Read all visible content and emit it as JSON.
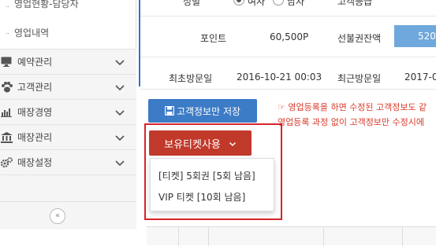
{
  "sidebar": {
    "sub_items": [
      "영업현황-담당자",
      "영업내역"
    ],
    "menus": [
      {
        "label": "예약관리",
        "icon": "monitor-icon"
      },
      {
        "label": "고객관리",
        "icon": "paw-icon"
      },
      {
        "label": "매장경영",
        "icon": "bar-chart-icon"
      },
      {
        "label": "매장관리",
        "icon": "building-icon"
      },
      {
        "label": "매장설정",
        "icon": "gears-icon"
      }
    ],
    "collapse_label": "«"
  },
  "customer_info": {
    "gender_label": "성별",
    "radio_option_1": "여자",
    "radio_option_2": "남자",
    "top_right_label": "고객등급",
    "points_label": "포인트",
    "points_value": "60,500P",
    "prepaid_label": "선불권잔액",
    "prepaid_value": "520,",
    "first_visit_label": "최초방문일",
    "first_visit_value": "2016-10-21 00:03",
    "last_visit_label": "최근방문일",
    "last_visit_value": "2017-0"
  },
  "actions": {
    "save_label": "고객정보만 저장",
    "notice_line1": "☞ 영업등록을 하면 수정된 고객정보도 같",
    "notice_line2": "영업등록 과정 없이 고객정보만 수정시에",
    "ticket_button_label": "보유티켓사용",
    "ticket_options": [
      "[티켓] 5회권 [5회 남음]",
      "VIP 티켓 [10회 남음]"
    ]
  },
  "colors": {
    "accent_blue": "#3c7bc6",
    "ticket_red": "#c0392b",
    "highlight_red": "#d8232a",
    "prepaid_box": "#6fa8dc"
  }
}
